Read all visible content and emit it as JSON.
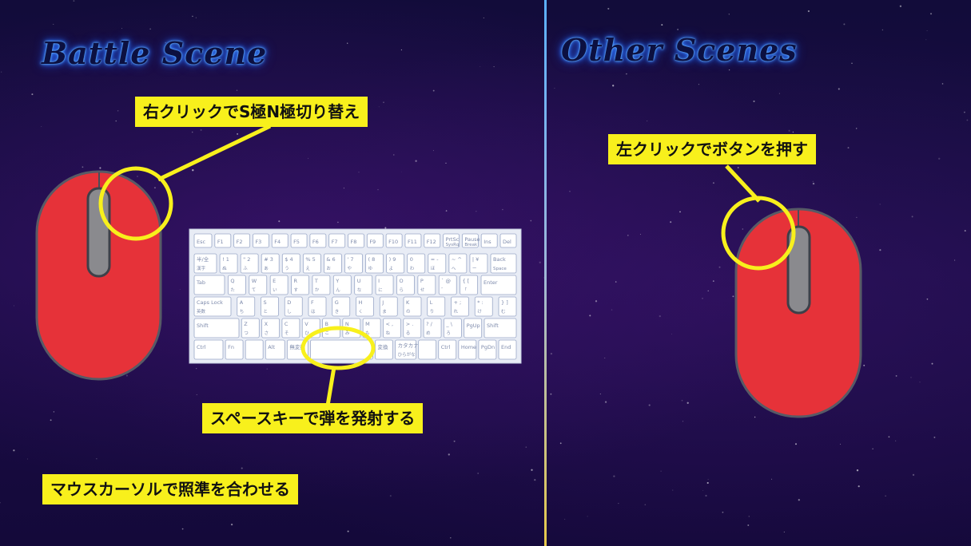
{
  "left_panel": {
    "title": "Battle Scene",
    "right_click_label": "右クリックでS極N極切り替え",
    "space_key_label": "スペースキーで弾を発射する",
    "cursor_label": "マウスカーソルで照準を合わせる"
  },
  "right_panel": {
    "title": "Other Scenes",
    "left_click_label": "左クリックでボタンを押す"
  },
  "colors": {
    "label_bg": "#f8f01c",
    "highlight_ring": "#f8f01c",
    "mouse_body": "#e63239",
    "keyboard_bg": "#e8ecf5",
    "key_outline": "#9aa8c8"
  },
  "keyboard": {
    "rows": [
      [
        {
          "main": "Esc"
        },
        {
          "main": "F1"
        },
        {
          "main": "F2"
        },
        {
          "main": "F3"
        },
        {
          "main": "F4"
        },
        {
          "main": "F5"
        },
        {
          "main": "F6"
        },
        {
          "main": "F7"
        },
        {
          "main": "F8"
        },
        {
          "main": "F9"
        },
        {
          "main": "F10"
        },
        {
          "main": "F11"
        },
        {
          "main": "F12"
        },
        {
          "main": "PrtSc",
          "sub": "SysRq"
        },
        {
          "main": "Pause",
          "sub": "Break"
        },
        {
          "main": "Ins"
        },
        {
          "main": "Del"
        }
      ],
      [
        {
          "main": "半/全",
          "sub": "漢字"
        },
        {
          "main": "! 1",
          "sub": "ぬ"
        },
        {
          "main": "\" 2",
          "sub": "ふ"
        },
        {
          "main": "# 3",
          "sub": "あ"
        },
        {
          "main": "$ 4",
          "sub": "う"
        },
        {
          "main": "% 5",
          "sub": "え"
        },
        {
          "main": "& 6",
          "sub": "お"
        },
        {
          "main": "' 7",
          "sub": "や"
        },
        {
          "main": "( 8",
          "sub": "ゆ"
        },
        {
          "main": ") 9",
          "sub": "よ"
        },
        {
          "main": "0",
          "sub": "わ"
        },
        {
          "main": "= -",
          "sub": "ほ"
        },
        {
          "main": "~ ^",
          "sub": "へ"
        },
        {
          "main": "| ¥",
          "sub": "ー"
        },
        {
          "main": "Back",
          "sub": "Space"
        }
      ],
      [
        {
          "main": "Tab"
        },
        {
          "main": "Q",
          "sub": "た"
        },
        {
          "main": "W",
          "sub": "て"
        },
        {
          "main": "E",
          "sub": "い"
        },
        {
          "main": "R",
          "sub": "す"
        },
        {
          "main": "T",
          "sub": "か"
        },
        {
          "main": "Y",
          "sub": "ん"
        },
        {
          "main": "U",
          "sub": "な"
        },
        {
          "main": "I",
          "sub": "に"
        },
        {
          "main": "O",
          "sub": "ら"
        },
        {
          "main": "P",
          "sub": "せ"
        },
        {
          "main": "` @",
          "sub": "゛"
        },
        {
          "main": "{ [",
          "sub": "「"
        },
        {
          "main": "Enter"
        }
      ],
      [
        {
          "main": "Caps Lock",
          "sub": "英数"
        },
        {
          "main": "A",
          "sub": "ち"
        },
        {
          "main": "S",
          "sub": "と"
        },
        {
          "main": "D",
          "sub": "し"
        },
        {
          "main": "F",
          "sub": "は"
        },
        {
          "main": "G",
          "sub": "き"
        },
        {
          "main": "H",
          "sub": "く"
        },
        {
          "main": "J",
          "sub": "ま"
        },
        {
          "main": "K",
          "sub": "の"
        },
        {
          "main": "L",
          "sub": "り"
        },
        {
          "main": "+ ;",
          "sub": "れ"
        },
        {
          "main": "* :",
          "sub": "け"
        },
        {
          "main": "} ]",
          "sub": "む"
        }
      ],
      [
        {
          "main": "Shift"
        },
        {
          "main": "Z",
          "sub": "つ"
        },
        {
          "main": "X",
          "sub": "さ"
        },
        {
          "main": "C",
          "sub": "そ"
        },
        {
          "main": "V",
          "sub": "ひ"
        },
        {
          "main": "B",
          "sub": "こ"
        },
        {
          "main": "N",
          "sub": "み"
        },
        {
          "main": "M",
          "sub": "も"
        },
        {
          "main": "< ,",
          "sub": "ね"
        },
        {
          "main": "> .",
          "sub": "る"
        },
        {
          "main": "? /",
          "sub": "め"
        },
        {
          "main": "_ \\",
          "sub": "ろ"
        },
        {
          "main": "PgUp"
        },
        {
          "main": "Shift"
        }
      ],
      [
        {
          "main": "Ctrl"
        },
        {
          "main": "Fn"
        },
        {
          "main": ""
        },
        {
          "main": "Alt"
        },
        {
          "main": "無変換"
        },
        {
          "main": ""
        },
        {
          "main": "変換"
        },
        {
          "main": "カタカナ",
          "sub": "ひらがな"
        },
        {
          "main": ""
        },
        {
          "main": "Ctrl"
        },
        {
          "main": "Home"
        },
        {
          "main": "PgDn"
        },
        {
          "main": "End"
        }
      ]
    ]
  }
}
